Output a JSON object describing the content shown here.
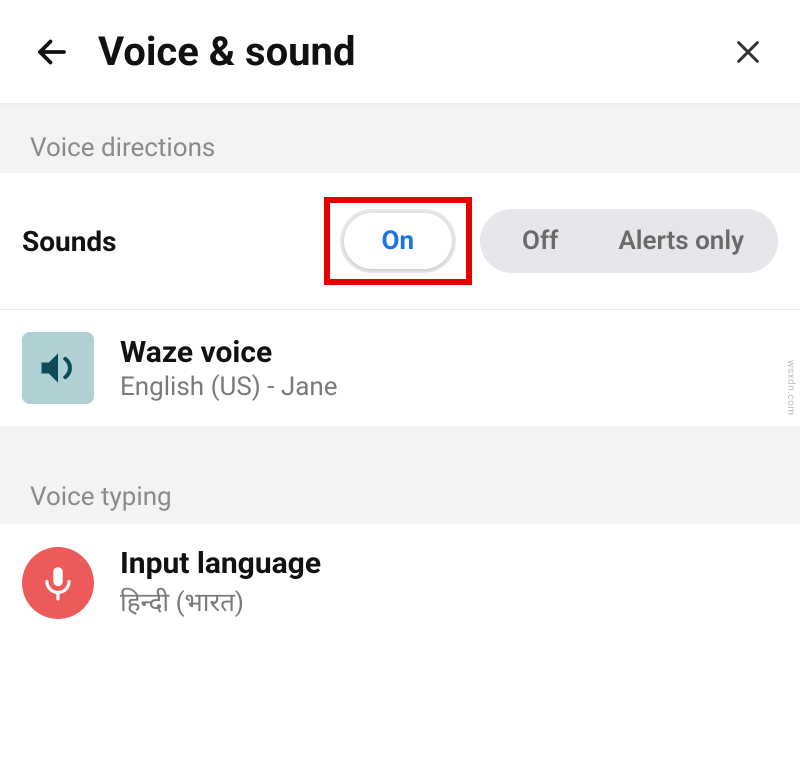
{
  "header": {
    "title": "Voice & sound"
  },
  "sections": {
    "voice_directions": {
      "label": "Voice directions",
      "sounds": {
        "label": "Sounds",
        "options": {
          "on": "On",
          "off": "Off",
          "alerts_only": "Alerts only"
        },
        "selected": "On"
      },
      "waze_voice": {
        "title": "Waze voice",
        "subtitle": "English (US) - Jane"
      }
    },
    "voice_typing": {
      "label": "Voice typing",
      "input_language": {
        "title": "Input language",
        "subtitle": "हिन्दी (भारत)"
      }
    }
  },
  "watermark": "wsxdn.com"
}
